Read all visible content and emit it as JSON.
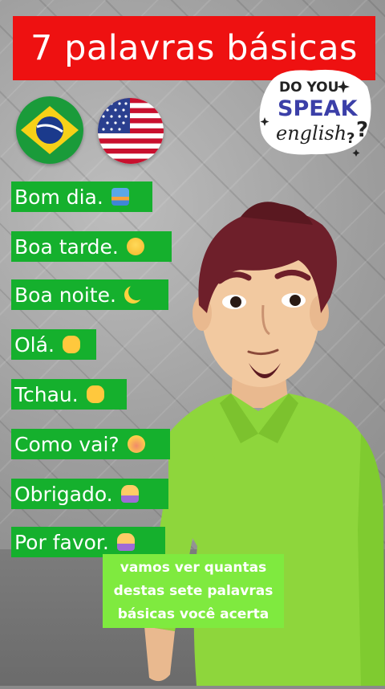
{
  "title": "7 palavras básicas",
  "flags": [
    {
      "name": "brazil-flag-icon"
    },
    {
      "name": "usa-flag-icon"
    }
  ],
  "sticker": {
    "line1": "DO YOU",
    "line2": "SPEAK",
    "line3": "english",
    "mark": "?"
  },
  "phrases": [
    {
      "text": "Bom dia.",
      "emoji": "sunrise-icon"
    },
    {
      "text": "Boa tarde.",
      "emoji": "smiling-face-icon"
    },
    {
      "text": "Boa noite.",
      "emoji": "crescent-moon-icon"
    },
    {
      "text": "Olá.",
      "emoji": "waving-hand-icon"
    },
    {
      "text": "Tchau.",
      "emoji": "waving-hand-icon"
    },
    {
      "text": "Como vai?",
      "emoji": "flushed-face-icon"
    },
    {
      "text": "Obrigado.",
      "emoji": "folded-hands-icon"
    },
    {
      "text": "Por favor.",
      "emoji": "folded-hands-icon"
    }
  ],
  "caption": {
    "line1": "vamos ver quantas",
    "line2": "destas sete palavras",
    "line3": "básicas você acerta"
  },
  "colors": {
    "title_bg": "#ee1111",
    "phrase_bg": "#15b02d",
    "caption_bg": "#7fea3f",
    "shirt": "#8ed63c"
  }
}
